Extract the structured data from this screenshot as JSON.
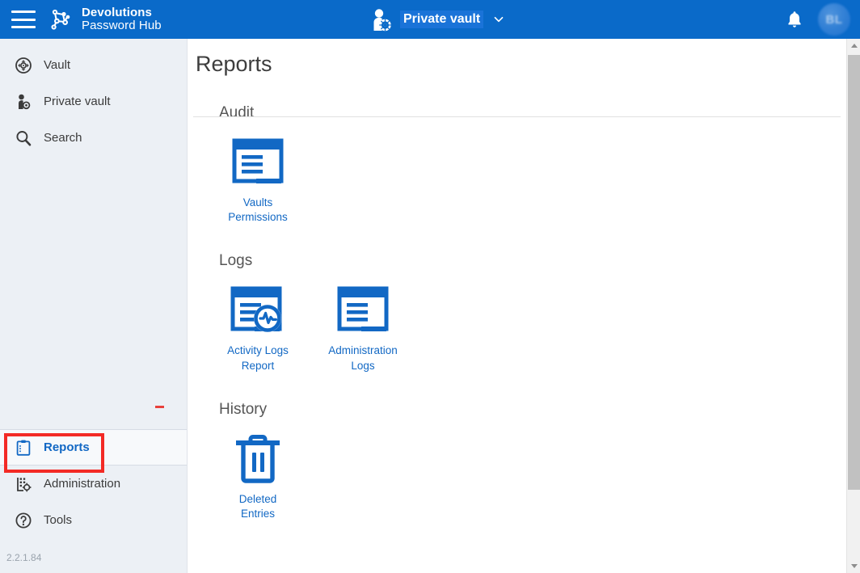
{
  "header": {
    "menu_icon": "hamburger-icon",
    "brand_line1": "Devolutions",
    "brand_line2": "Password Hub",
    "brand_logo_icon": "devolutions-node-logo-icon",
    "vault_icon": "private-vault-user-icon",
    "vault_name": "Private vault",
    "vault_chevron_icon": "chevron-down-icon",
    "notifications_icon": "bell-icon",
    "avatar_initials": "BL",
    "colors": {
      "header_blue": "#0a6ac9",
      "accent_blue": "#1268c4",
      "sidebar_bg": "#ecf0f5",
      "highlight_red": "#f32a25"
    }
  },
  "sidebar": {
    "top_items": [
      {
        "label": "Vault",
        "icon": "vault-icon"
      },
      {
        "label": "Private vault",
        "icon": "private-vault-icon"
      },
      {
        "label": "Search",
        "icon": "search-icon"
      }
    ],
    "bottom_items": [
      {
        "label": "Reports",
        "icon": "clipboard-reports-icon",
        "selected": true
      },
      {
        "label": "Administration",
        "icon": "administration-icon",
        "selected": false
      },
      {
        "label": "Tools",
        "icon": "question-tools-icon",
        "selected": false
      }
    ],
    "version": "2.2.1.84"
  },
  "main": {
    "page_title": "Reports",
    "sections": [
      {
        "title": "Audit",
        "cards": [
          {
            "label": "Vaults\nPermissions",
            "icon": "report-document-icon"
          }
        ]
      },
      {
        "title": "Logs",
        "cards": [
          {
            "label": "Activity Logs\nReport",
            "icon": "report-pulse-icon"
          },
          {
            "label": "Administration\nLogs",
            "icon": "report-window-icon"
          }
        ]
      },
      {
        "title": "History",
        "cards": [
          {
            "label": "Deleted\nEntries",
            "icon": "trash-bin-icon"
          }
        ]
      }
    ]
  },
  "scrollbar": {
    "up_icon": "scroll-up-arrow-icon",
    "down_icon": "scroll-down-arrow-icon",
    "thumb": "scroll-thumb"
  }
}
